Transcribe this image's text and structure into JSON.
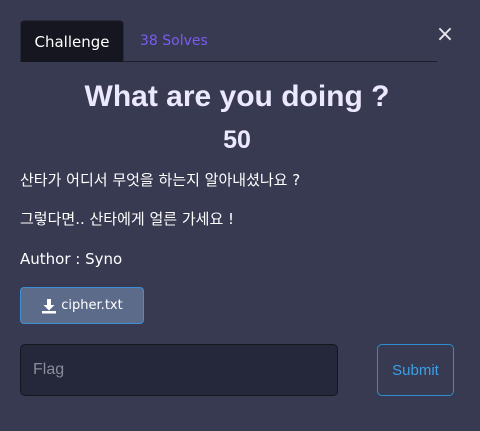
{
  "tabs": {
    "challenge": "Challenge",
    "solves": "38 Solves"
  },
  "close_label": "×",
  "challenge": {
    "title": "What are you doing ?",
    "points": "50",
    "description_1": "산타가 어디서 무엇을 하는지 알아내셨나요 ?",
    "description_2": "그렇다면.. 산타에게 얼른 가세요 !",
    "author": "Author : Syno"
  },
  "file": {
    "name": "cipher.txt",
    "icon": "download-icon"
  },
  "submission": {
    "placeholder": "Flag",
    "value": "",
    "submit_label": "Submit"
  },
  "colors": {
    "background": "#383a52",
    "tab_active": "#15161f",
    "solves_link": "#7a5cf0",
    "file_button": "#5d6b8a",
    "submit_accent": "#3aa0e6"
  }
}
